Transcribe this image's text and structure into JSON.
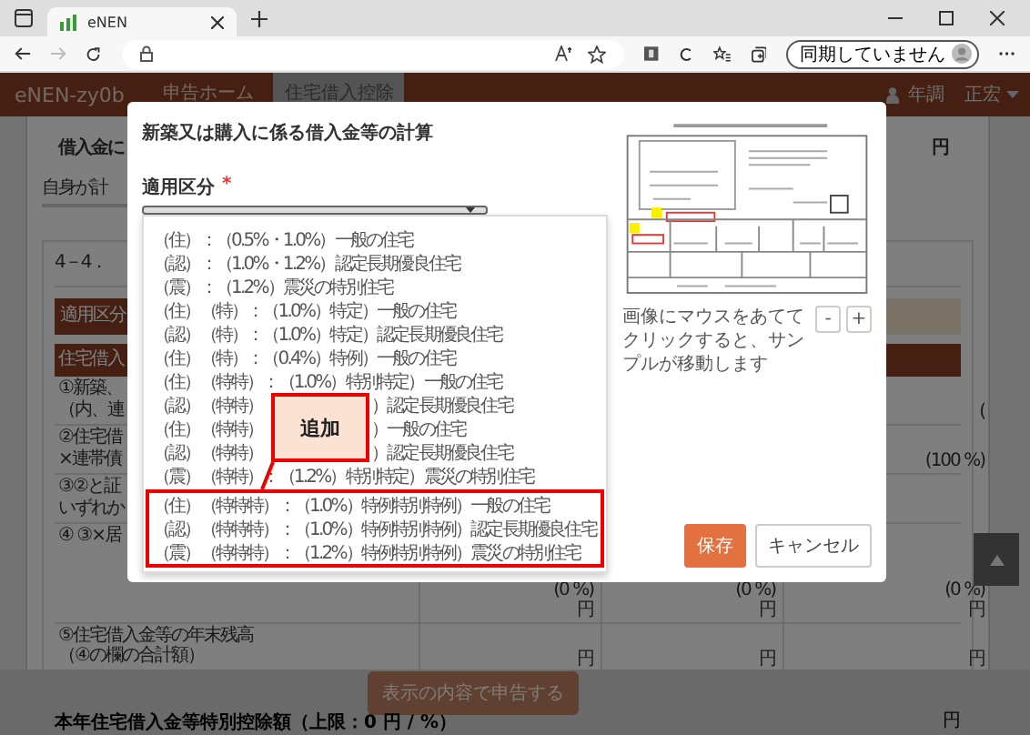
{
  "browser": {
    "tab_title": "eNEN",
    "sync_button": "同期していません"
  },
  "app_header": {
    "brand": "eNEN-zy0b",
    "nav": [
      {
        "label": "申告ホーム",
        "selected": false
      },
      {
        "label": "住宅借入控除",
        "selected": true
      }
    ],
    "year_link": "年調",
    "user_menu": "正宏"
  },
  "page": {
    "top_row": {
      "label": "借入金に",
      "value": "円"
    },
    "self_calc_label": "自身が計",
    "section_title": "4－4．",
    "category_label": "適用区分",
    "table_header": "住宅借入",
    "rows": [
      {
        "lines": [
          "①新築、",
          "（内、連"
        ],
        "col_c": [
          "("
        ]
      },
      {
        "lines": [
          "②住宅借",
          "×連帯債"
        ],
        "col_c": [
          "(100 %)"
        ]
      },
      {
        "lines": [
          "③②と証",
          "いずれか"
        ]
      },
      {
        "lines": [
          "④ ③×居"
        ],
        "col_a": [
          "(0 %)",
          "円"
        ],
        "col_b": [
          "(0 %)",
          "円"
        ],
        "col_c": [
          "(0 %)",
          "円"
        ]
      },
      {
        "lines": [
          "⑤住宅借入金等の年末残高",
          "（④の欄の合計額）"
        ],
        "col_a": [
          "円"
        ],
        "col_b": [
          "円"
        ],
        "col_c": [
          "円"
        ]
      }
    ]
  },
  "bottom_bar": {
    "total_label": "本年住宅借入金等特別控除額（上限：0 円 / %）",
    "submit_button": "表示の内容で申告する",
    "total_value": "円"
  },
  "modal": {
    "title": "新築又は購入に係る借入金等の計算",
    "field_label": "適用区分",
    "required_mark": "*",
    "options": [
      {
        "text": "（住）：（0.5%・1.0%）一般の住宅"
      },
      {
        "text": "（認）：（1.0%・1.2%）認定長期優良住宅"
      },
      {
        "text": "（震）：（1.2%）震災の特別住宅"
      },
      {
        "text": "（住）（特）：（1.0%）特定）一般の住宅"
      },
      {
        "text": "（認）（特）：（1.0%）特定）認定長期優良住宅"
      },
      {
        "text": "（住）（特）：（0.4%）特例）一般の住宅"
      },
      {
        "text": "（住）（特特）：（1.0%）特別特定）一般の住宅"
      },
      {
        "head": "（認）（特特）",
        "tail": "）認定長期優良住宅"
      },
      {
        "head": "（住）（特特）",
        "tail": "）一般の住宅"
      },
      {
        "head": "（認）（特特）",
        "tail": "）認定長期優良住宅"
      },
      {
        "text": "（震）（特特）：（1.2%）特別特定）震災の特別住宅"
      }
    ],
    "added_options": [
      {
        "text": "（住）（特特特）：（1.0%）特例特別特例）一般の住宅"
      },
      {
        "text": "（認）（特特特）：（1.0%）特例特別特例）認定長期優良住宅"
      },
      {
        "text": "（震）（特特特）：（1.2%）特例特別特例）震災の特別住宅"
      }
    ],
    "callout": "追加",
    "hint": "画像にマウスをあててクリックすると、サンプルが移動します",
    "zoom_buttons": [
      "-",
      "+"
    ],
    "buttons": [
      {
        "label": "保存",
        "kind": "primary"
      },
      {
        "label": "キャンセル",
        "kind": "secondary"
      }
    ]
  }
}
